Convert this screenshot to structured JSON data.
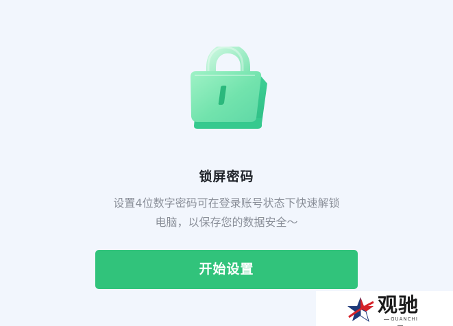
{
  "dialog": {
    "title": "锁屏密码",
    "description_line1": "设置4位数字密码可在登录账号状态下快速解锁",
    "description_line2": "电脑，以保存您的数据安全～",
    "start_button_label": "开始设置"
  },
  "watermark": {
    "name": "观驰",
    "sub": "GUANCHI"
  },
  "icons": {
    "lock": "lock-icon",
    "watermark_star": "star-icon"
  },
  "colors": {
    "background": "#f2f6fd",
    "accent": "#31c37b",
    "lock_green": "#6ee7b0"
  }
}
